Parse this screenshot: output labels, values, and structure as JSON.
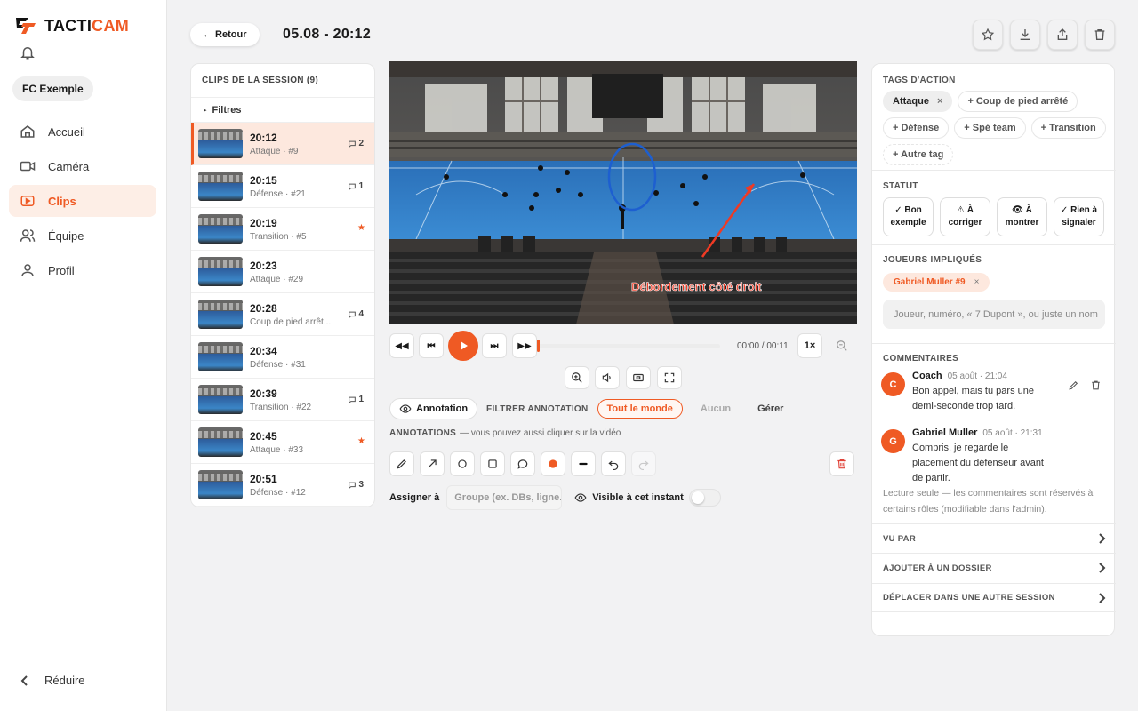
{
  "app": {
    "name_part1": "TACTI",
    "name_part2": "CAM",
    "club": "FC Exemple"
  },
  "nav": {
    "items": [
      {
        "label": "Accueil",
        "icon": "home-icon"
      },
      {
        "label": "Caméra",
        "icon": "camera-icon"
      },
      {
        "label": "Clips",
        "icon": "clips-icon",
        "active": true
      },
      {
        "label": "Équipe",
        "icon": "team-icon"
      },
      {
        "label": "Profil",
        "icon": "profile-icon"
      }
    ],
    "reduce_label": "Réduire"
  },
  "header": {
    "back_label": "← Retour",
    "title": "05.08 - 20:12"
  },
  "clips": {
    "title": "CLIPS DE LA SESSION (9)",
    "filters_label": "Filtres",
    "items": [
      {
        "time": "20:12",
        "sub": "Attaque · #9",
        "comments": "2"
      },
      {
        "time": "20:15",
        "sub": "Défense · #21",
        "comments": "1"
      },
      {
        "time": "20:19",
        "sub": "Transition · #5",
        "star": "★"
      },
      {
        "time": "20:23",
        "sub": "Attaque · #29"
      },
      {
        "time": "20:28",
        "sub": "Coup de pied arrêt...",
        "comments": "4"
      },
      {
        "time": "20:34",
        "sub": "Défense · #31"
      },
      {
        "time": "20:39",
        "sub": "Transition · #22",
        "comments": "1"
      },
      {
        "time": "20:45",
        "sub": "Attaque · #33",
        "star": "★"
      },
      {
        "time": "20:51",
        "sub": "Défense · #12",
        "comments": "3"
      }
    ]
  },
  "video": {
    "overlay_text": "Débordement côté droit"
  },
  "player": {
    "time": "00:00 / 00:11",
    "speed": "1×",
    "progress": 0
  },
  "annotation": {
    "toggle_label": "Annotation",
    "filter_label": "FILTRER ANNOTATION",
    "filter_all": "Tout le monde",
    "filter_none": "Aucun",
    "filter_manage": "Gérer",
    "hint_title": "ANNOTATIONS",
    "hint_text": "— vous pouvez aussi cliquer sur la vidéo",
    "assign_label": "Assigner à",
    "assign_placeholder": "Groupe (ex. DBs, ligne...)",
    "visible_label": "Visible à cet instant",
    "color": "#ef5a24"
  },
  "tags": {
    "title": "TAGS D'ACTION",
    "selected": "Attaque",
    "options": [
      "+ Coup de pied arrêté",
      "+ Défense",
      "+ Spé team",
      "+ Transition"
    ],
    "other": "+ Autre tag"
  },
  "status": {
    "title": "STATUT",
    "options": [
      {
        "l1": "✓ Bon",
        "l2": "exemple"
      },
      {
        "l1": "⚠ À",
        "l2": "corriger"
      },
      {
        "l1": "👁 À",
        "l2": "montrer"
      },
      {
        "l1": "✓ Rien à",
        "l2": "signaler"
      }
    ]
  },
  "players": {
    "title": "JOUEURS IMPLIQUÉS",
    "chip": "Gabriel Muller #9",
    "placeholder": "Joueur, numéro, « 7 Dupont », ou juste un nom"
  },
  "comments": {
    "title": "COMMENTAIRES",
    "items": [
      {
        "initial": "C",
        "author": "Coach",
        "date": "05 août · 21:04",
        "body": "Bon appel, mais tu pars une demi-seconde trop tard."
      },
      {
        "initial": "G",
        "author": "Gabriel Muller",
        "date": "05 août · 21:31",
        "body": "Compris, je regarde le placement du défenseur avant de partir."
      }
    ],
    "readonly": "Lecture seule — les commentaires sont réservés à certains rôles (modifiable dans l'admin)."
  },
  "links": {
    "seen_by": "VU PAR",
    "add_folder": "AJOUTER À UN DOSSIER",
    "move_session": "DÉPLACER DANS UNE AUTRE SESSION"
  },
  "colors": {
    "accent": "#ef5a24",
    "accent_bg": "#fde8de"
  }
}
